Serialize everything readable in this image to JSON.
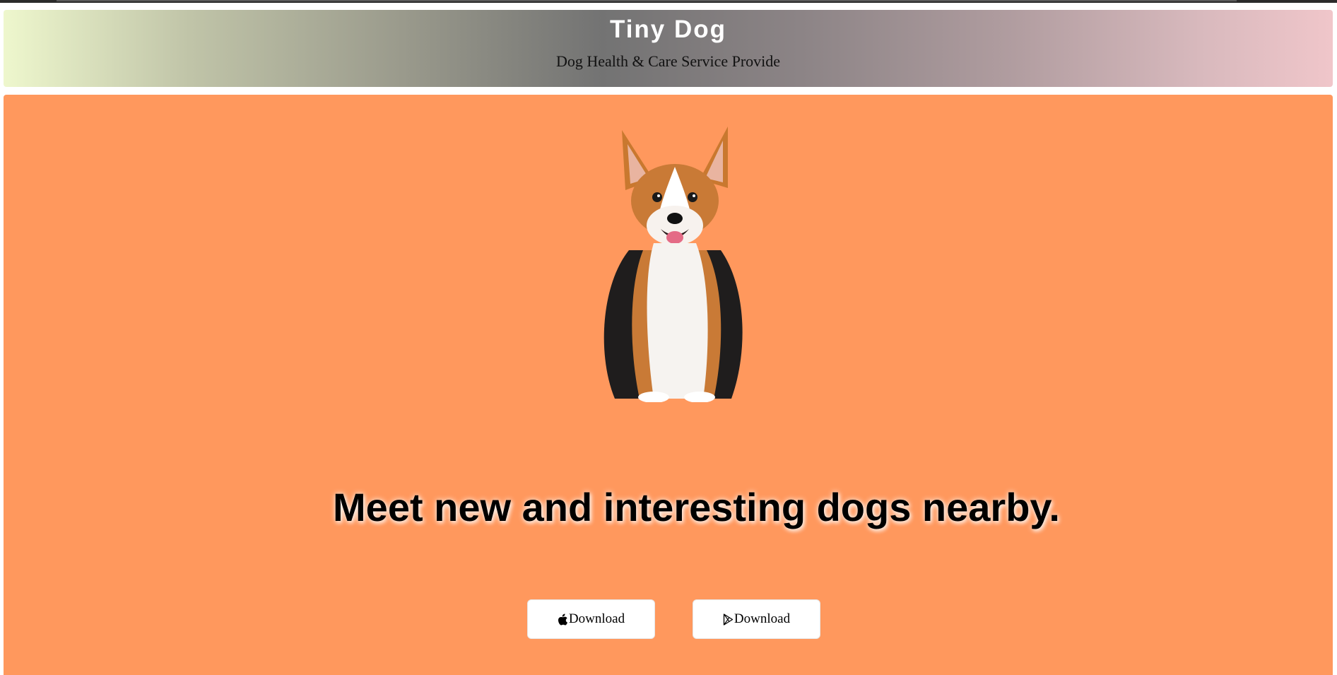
{
  "header": {
    "brand": "Tiny Dog",
    "tagline": "Dog Health & Care Service Provide"
  },
  "hero": {
    "title": "Meet new and interesting dogs nearby.",
    "image_alt": "corgi-dog",
    "background_color": "#ff985d"
  },
  "buttons": [
    {
      "label": "Download",
      "icon": "apple-icon"
    },
    {
      "label": "Download",
      "icon": "google-play-icon"
    }
  ]
}
